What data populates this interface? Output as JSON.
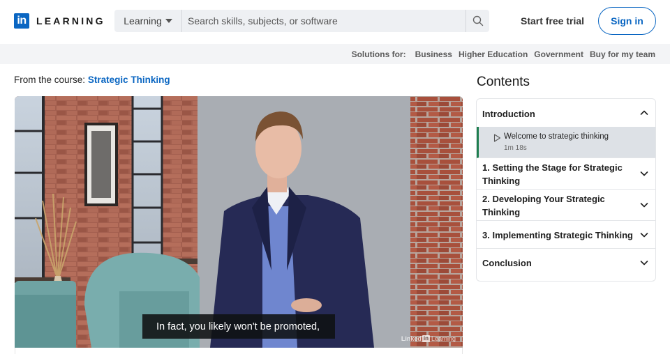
{
  "header": {
    "logo_mark": "in",
    "logo_text": "LEARNING",
    "search_scope": "Learning",
    "search_placeholder": "Search skills, subjects, or software",
    "search_value": "",
    "start_trial": "Start free trial",
    "sign_in": "Sign in",
    "brand_color": "#0a66c2"
  },
  "subnav": {
    "label": "Solutions for:",
    "links": [
      "Business",
      "Higher Education",
      "Government",
      "Buy for my team"
    ]
  },
  "course": {
    "prefix": "From the course:",
    "title": "Strategic Thinking"
  },
  "video": {
    "caption": "In fact, you likely won't be promoted,",
    "watermark_left": "Linked",
    "watermark_in": "in",
    "watermark_right": "Learning"
  },
  "contents": {
    "title": "Contents",
    "sections": [
      {
        "title": "Introduction",
        "expanded": true,
        "lessons": [
          {
            "title": "Welcome to strategic thinking",
            "duration": "1m 18s",
            "active": true
          }
        ]
      },
      {
        "title": "1. Setting the Stage for Strategic Thinking",
        "expanded": false
      },
      {
        "title": "2. Developing Your Strategic Thinking",
        "expanded": false
      },
      {
        "title": "3. Implementing Strategic Thinking",
        "expanded": false
      },
      {
        "title": "Conclusion",
        "expanded": false
      }
    ],
    "active_color": "#1e7e4f"
  }
}
